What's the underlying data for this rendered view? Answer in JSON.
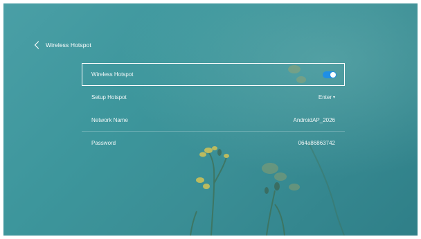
{
  "header": {
    "title": "Wireless Hotspot",
    "back_icon": "chevron-left-icon"
  },
  "settings": {
    "hotspot_toggle": {
      "label": "Wireless Hotspot",
      "enabled": true,
      "color": "#1f8fe6"
    },
    "setup_hotspot": {
      "label": "Setup Hotspot",
      "value": "Enter"
    },
    "network_name": {
      "label": "Network Name",
      "value": "AndroidAP_2026"
    },
    "password": {
      "label": "Password",
      "value": "064a86863742"
    }
  }
}
